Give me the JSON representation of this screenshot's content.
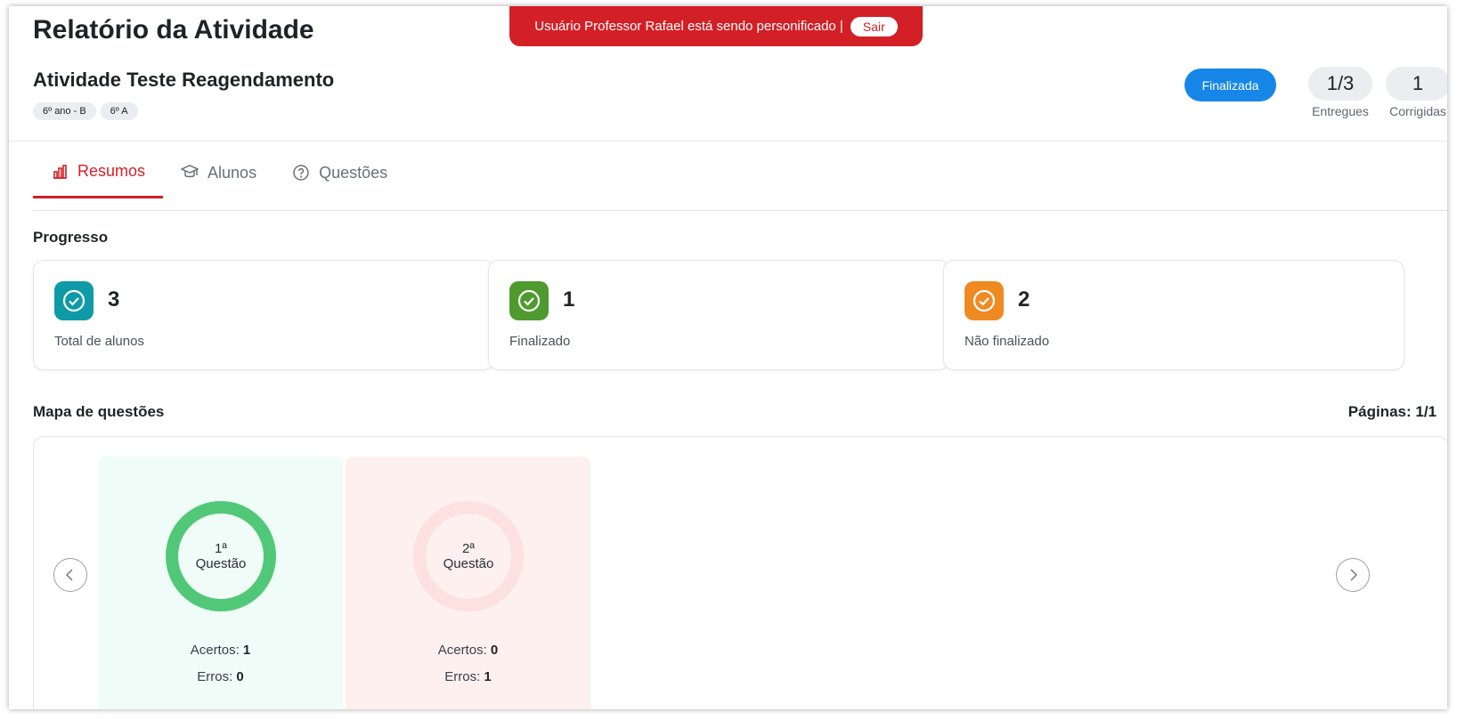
{
  "banner": {
    "message": "Usuário Professor Rafael está sendo personificado |",
    "exit_label": "Sair",
    "color": "#d32027"
  },
  "header": {
    "page_title": "Relatório da Atividade",
    "activity_title": "Atividade Teste Reagendamento",
    "classes": [
      "6º ano - B",
      "6º A"
    ],
    "status": "Finalizada",
    "stats": {
      "entregues": {
        "value": "1/3",
        "label": "Entregues"
      },
      "corrigidas": {
        "value": "1",
        "label": "Corrigidas"
      }
    }
  },
  "tabs": [
    {
      "label": "Resumos",
      "icon": "bar-chart-icon",
      "active": true
    },
    {
      "label": "Alunos",
      "icon": "graduation-cap-icon",
      "active": false
    },
    {
      "label": "Questões",
      "icon": "question-circle-icon",
      "active": false
    }
  ],
  "progress": {
    "title": "Progresso",
    "cards": [
      {
        "value": "3",
        "label": "Total de alunos",
        "color": "#0e9aa7",
        "icon": "check-circle-icon"
      },
      {
        "value": "1",
        "label": "Finalizado",
        "color": "#4f9a2f",
        "icon": "check-circle-icon"
      },
      {
        "value": "2",
        "label": "Não finalizado",
        "color": "#ef8a23",
        "icon": "check-circle-icon"
      }
    ]
  },
  "question_map": {
    "title": "Mapa de questões",
    "pages_label": "Páginas: 1/1",
    "prev_icon": "chevron-left-icon",
    "next_icon": "chevron-right-icon",
    "questions": [
      {
        "label_top": "1ª",
        "label_bottom": "Questão",
        "acertos_label": "Acertos:",
        "acertos": "1",
        "erros_label": "Erros:",
        "erros": "0",
        "accuracy": 1.0,
        "bg": "#effcf7",
        "ring": "#50c878",
        "ring_track": "#d8f2e2"
      },
      {
        "label_top": "2ª",
        "label_bottom": "Questão",
        "acertos_label": "Acertos:",
        "acertos": "0",
        "erros_label": "Erros:",
        "erros": "1",
        "accuracy": 0.0,
        "bg": "#fff0f0",
        "ring": "#f3a7a7",
        "ring_track": "#fde0e0"
      }
    ]
  }
}
